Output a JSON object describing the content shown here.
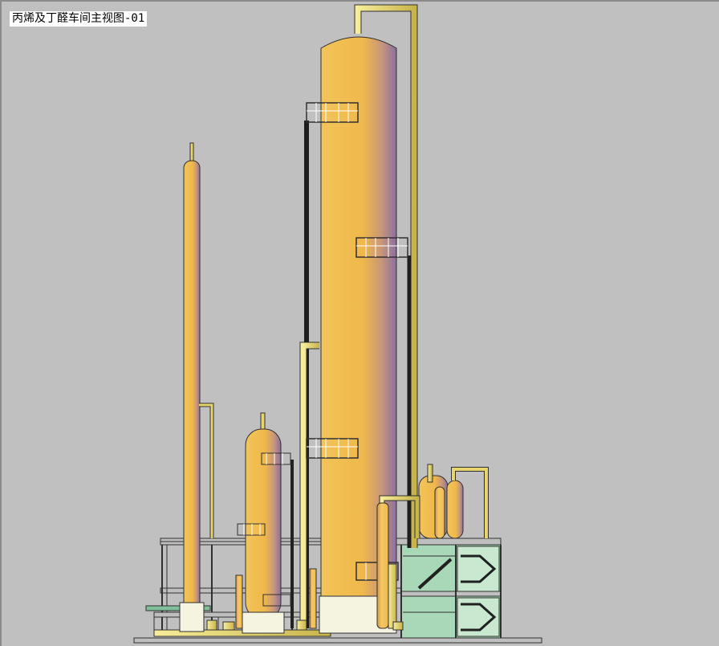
{
  "drawing": {
    "title": "丙烯及丁醛车间主视图-01"
  },
  "colors": {
    "background": "#c0c0c0",
    "vessel_light": "#f7d580",
    "vessel_mid": "#f0b84a",
    "vessel_shade": "#8a70a0",
    "pipe": "#e8d46c",
    "structure_fill": "#a8d8b8",
    "structure_line": "#303030",
    "platform_rail": "#ffffff",
    "drain_pipe": "#2a2a2a",
    "skirt": "#f4f4e0"
  },
  "legend_icons": [
    "column-icon",
    "vessel-icon",
    "pipe-icon",
    "platform-icon",
    "stair-icon"
  ]
}
